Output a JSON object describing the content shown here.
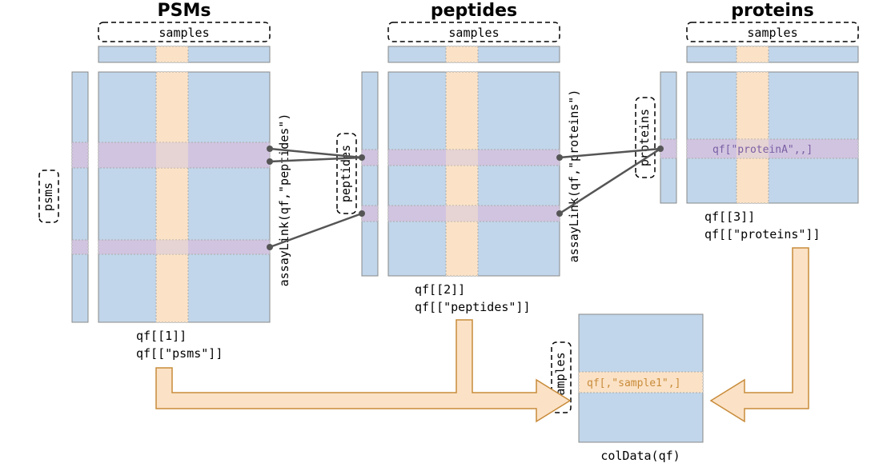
{
  "titles": {
    "psms": "PSMs",
    "peptides": "peptides",
    "proteins": "proteins"
  },
  "samples_label": "samples",
  "row_labels": {
    "psms": "psms",
    "peptides": "peptides",
    "proteins": "proteins"
  },
  "link_labels": {
    "peptides": "assayLink(qf,\"peptides\")",
    "proteins": "assayLink(qf,\"proteins\")"
  },
  "accessors": {
    "psms": {
      "l1": "qf[[1]]",
      "l2": "qf[[\"psms\"]]"
    },
    "peptides": {
      "l1": "qf[[2]]",
      "l2": "qf[[\"peptides\"]]"
    },
    "proteins": {
      "l1": "qf[[3]]",
      "l2": "qf[[\"proteins\"]]"
    }
  },
  "inset": {
    "proteinA": "qf[\"proteinA\",,]",
    "sample1": "qf[,\"sample1\",]"
  },
  "coldata": {
    "samples_label": "samples",
    "label": "colData(qf)"
  }
}
